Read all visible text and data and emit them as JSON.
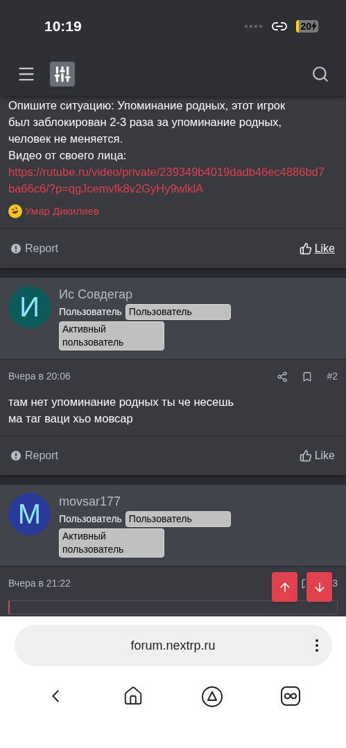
{
  "status_bar": {
    "time": "10:19",
    "battery": "20"
  },
  "posts": [
    {
      "body_lines": [
        "Опишите ситуацию: Упоминание родных, этот игрок",
        "был заблокирован 2-3 раза за упоминание родных,",
        "человек не меняется.",
        "Видео от своего лица:"
      ],
      "link": "https://rutube.ru/video/private/239349b4019dadb46ec4886bd7ba66c6/?p=qgJcemvfk8v2GyHy9wlklA",
      "reactions": [
        {
          "name": "Умар Дикилиев"
        }
      ],
      "report": "Report",
      "like": {
        "label": "Like",
        "liked": true
      }
    },
    {
      "author": {
        "initial": "И",
        "name": "Ис Совдегар",
        "color": "#0c5a5a",
        "role": "Пользователь",
        "badges": [
          "Пользователь",
          "Активный пользователь"
        ]
      },
      "date": "Вчера в 20:06",
      "number": "#2",
      "body_lines": [
        "там нет упоминание родных ты че несешь",
        "ма таг ваци хьо мовсар"
      ],
      "report": "Report",
      "like": {
        "label": "Like",
        "liked": false
      }
    },
    {
      "author": {
        "initial": "М",
        "name": "movsar177",
        "color": "#2a3a9a",
        "role": "Пользователь",
        "badges": [
          "Пользователь",
          "Активный пользователь"
        ]
      },
      "date": "Вчера в 21:22",
      "number": "3"
    }
  ],
  "browser": {
    "url": "forum.nextrp.ru"
  }
}
